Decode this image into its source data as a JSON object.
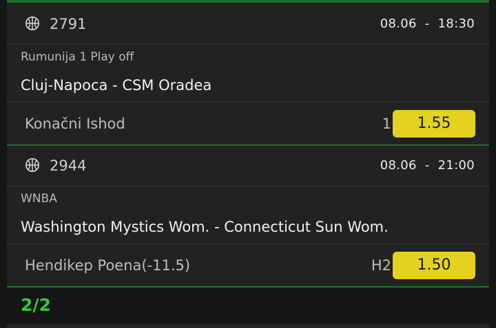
{
  "footer": {
    "count": "2/2"
  },
  "bets": [
    {
      "code": "2791",
      "sport_icon": "basketball-icon",
      "date": "08.06",
      "time": "18:30",
      "league": "Rumunija 1 Play off",
      "match": "Cluj-Napoca - CSM Oradea",
      "market": "Konačni Ishod",
      "pick": "1",
      "odd": "1.55"
    },
    {
      "code": "2944",
      "sport_icon": "basketball-icon",
      "date": "08.06",
      "time": "21:00",
      "league": "WNBA",
      "match": "Washington Mystics Wom. - Connecticut Sun Wom.",
      "market": "Hendikep Poena(-11.5)",
      "pick": "H2",
      "odd": "1.50"
    }
  ],
  "colors": {
    "background": "#222222",
    "accent_green": "#34c83c",
    "odd_button": "#e3d21e",
    "divider_green": "#1f6e2a"
  }
}
